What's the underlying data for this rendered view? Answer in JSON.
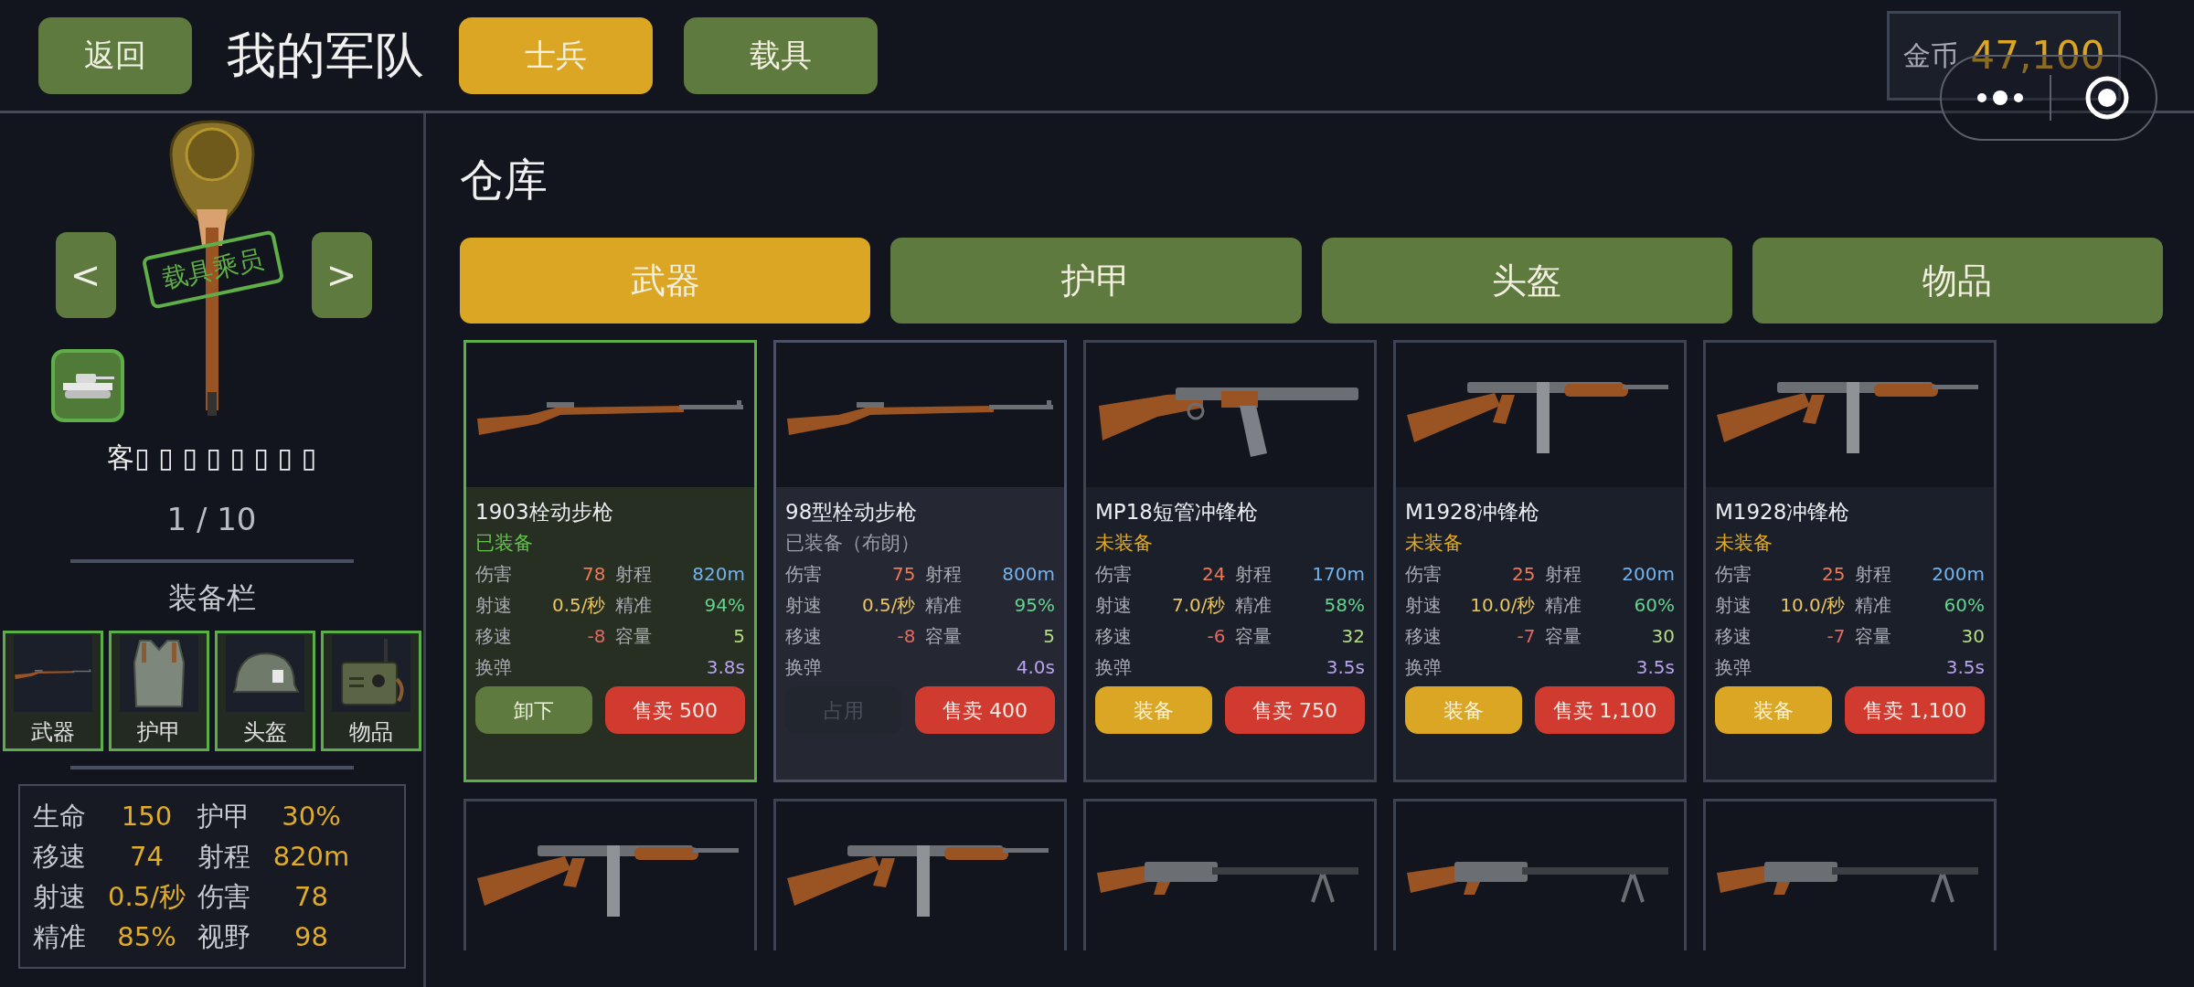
{
  "header": {
    "back": "返回",
    "title": "我的军队",
    "tabs": [
      {
        "label": "士兵",
        "selected": true
      },
      {
        "label": "载具",
        "selected": false
      }
    ],
    "coins": {
      "label": "金币",
      "value": "47,100"
    }
  },
  "soldier": {
    "prev": "<",
    "next": ">",
    "stamp": "载具乘员",
    "name": "客▯ ▯ ▯ ▯ ▯ ▯ ▯ ▯",
    "counter": "1 / 10",
    "equipment_title": "装备栏",
    "slots": [
      {
        "label": "武器",
        "kind": "rifle"
      },
      {
        "label": "护甲",
        "kind": "vest"
      },
      {
        "label": "头盔",
        "kind": "helmet"
      },
      {
        "label": "物品",
        "kind": "radio"
      }
    ],
    "stats": [
      {
        "label": "生命",
        "value": "150"
      },
      {
        "label": "护甲",
        "value": "30%"
      },
      {
        "label": "移速",
        "value": "74"
      },
      {
        "label": "射程",
        "value": "820m"
      },
      {
        "label": "射速",
        "value": "0.5/秒"
      },
      {
        "label": "伤害",
        "value": "78"
      },
      {
        "label": "精准",
        "value": "85%"
      },
      {
        "label": "视野",
        "value": "98"
      }
    ]
  },
  "warehouse": {
    "title": "仓库",
    "tabs": [
      {
        "label": "武器",
        "selected": true
      },
      {
        "label": "护甲",
        "selected": false
      },
      {
        "label": "头盔",
        "selected": false
      },
      {
        "label": "物品",
        "selected": false
      }
    ],
    "items": [
      {
        "kind": "rifle",
        "name": "1903栓动步枪",
        "equipped": true,
        "action_disabled": false,
        "status_text": "已装备",
        "stats": [
          {
            "label": "伤害",
            "value": "78"
          },
          {
            "label": "射程",
            "value": "820m"
          },
          {
            "label": "射速",
            "value": "0.5/秒"
          },
          {
            "label": "精准",
            "value": "94%"
          },
          {
            "label": "移速",
            "value": "-8"
          },
          {
            "label": "容量",
            "value": "5"
          },
          {
            "label": "换弹",
            "value": "3.8s"
          }
        ],
        "action": "卸下",
        "sell": "售卖 500"
      },
      {
        "kind": "rifle",
        "name": "98型栓动步枪",
        "equipped": false,
        "action_disabled": true,
        "status_text": "已装备（布朗）",
        "stats": [
          {
            "label": "伤害",
            "value": "75"
          },
          {
            "label": "射程",
            "value": "800m"
          },
          {
            "label": "射速",
            "value": "0.5/秒"
          },
          {
            "label": "精准",
            "value": "95%"
          },
          {
            "label": "移速",
            "value": "-8"
          },
          {
            "label": "容量",
            "value": "5"
          },
          {
            "label": "换弹",
            "value": "4.0s"
          }
        ],
        "action": "占用",
        "sell": "售卖 400"
      },
      {
        "kind": "smg",
        "name": "MP18短管冲锋枪",
        "equipped": false,
        "action_disabled": false,
        "status_text": "未装备",
        "stats": [
          {
            "label": "伤害",
            "value": "24"
          },
          {
            "label": "射程",
            "value": "170m"
          },
          {
            "label": "射速",
            "value": "7.0/秒"
          },
          {
            "label": "精准",
            "value": "58%"
          },
          {
            "label": "移速",
            "value": "-6"
          },
          {
            "label": "容量",
            "value": "32"
          },
          {
            "label": "换弹",
            "value": "3.5s"
          }
        ],
        "action": "装备",
        "sell": "售卖 750"
      },
      {
        "kind": "thompson",
        "name": "M1928冲锋枪",
        "equipped": false,
        "action_disabled": false,
        "status_text": "未装备",
        "stats": [
          {
            "label": "伤害",
            "value": "25"
          },
          {
            "label": "射程",
            "value": "200m"
          },
          {
            "label": "射速",
            "value": "10.0/秒"
          },
          {
            "label": "精准",
            "value": "60%"
          },
          {
            "label": "移速",
            "value": "-7"
          },
          {
            "label": "容量",
            "value": "30"
          },
          {
            "label": "换弹",
            "value": "3.5s"
          }
        ],
        "action": "装备",
        "sell": "售卖 1,100"
      },
      {
        "kind": "thompson",
        "name": "M1928冲锋枪",
        "equipped": false,
        "action_disabled": false,
        "status_text": "未装备",
        "stats": [
          {
            "label": "伤害",
            "value": "25"
          },
          {
            "label": "射程",
            "value": "200m"
          },
          {
            "label": "射速",
            "value": "10.0/秒"
          },
          {
            "label": "精准",
            "value": "60%"
          },
          {
            "label": "移速",
            "value": "-7"
          },
          {
            "label": "容量",
            "value": "30"
          },
          {
            "label": "换弹",
            "value": "3.5s"
          }
        ],
        "action": "装备",
        "sell": "售卖 1,100"
      }
    ],
    "more_items": [
      {
        "kind": "thompson"
      },
      {
        "kind": "thompson"
      },
      {
        "kind": "mg"
      },
      {
        "kind": "mg"
      },
      {
        "kind": "mg"
      }
    ]
  }
}
